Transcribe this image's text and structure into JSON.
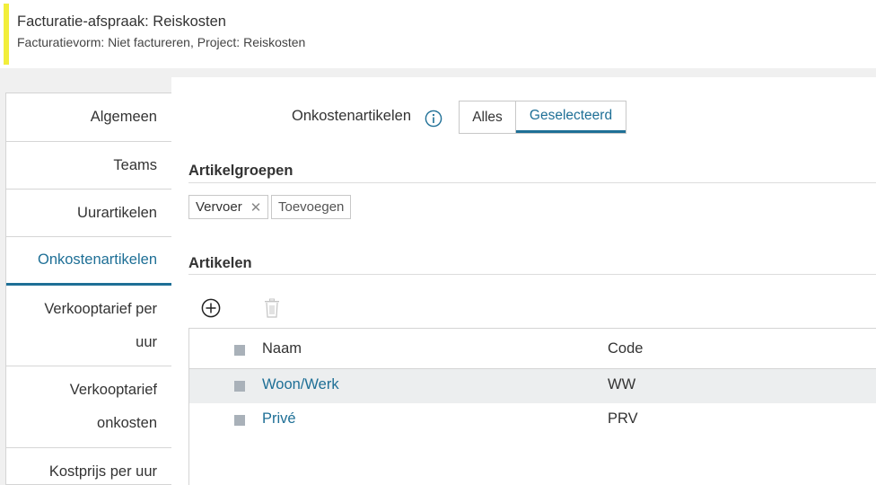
{
  "header": {
    "title": "Facturatie-afspraak: Reiskosten",
    "subtitle": "Facturatievorm: Niet factureren, Project: Reiskosten",
    "accent_color": "#f2ee3b"
  },
  "sidebar": {
    "items": [
      {
        "label": "Algemeen"
      },
      {
        "label": "Teams"
      },
      {
        "label": "Uurartikelen"
      },
      {
        "label": "Onkostenartikelen",
        "active": true
      },
      {
        "label_line1": "Verkooptarief per",
        "label_line2": "uur"
      },
      {
        "label_line1": "Verkooptarief",
        "label_line2": "onkosten"
      },
      {
        "label": "Kostprijs per uur"
      }
    ]
  },
  "main": {
    "field_label": "Onkostenartikelen",
    "info_icon": "info-circle-icon",
    "toggle": {
      "options": [
        "Alles",
        "Geselecteerd"
      ],
      "selected": "Geselecteerd"
    },
    "artikelgroepen": {
      "title": "Artikelgroepen",
      "tags": [
        "Vervoer"
      ],
      "remove_icon": "close-icon",
      "add_label": "Toevoegen"
    },
    "artikelen": {
      "title": "Artikelen",
      "add_icon": "plus-circle-icon",
      "delete_icon": "trash-icon",
      "columns": [
        "Naam",
        "Code"
      ],
      "rows": [
        {
          "name": "Woon/Werk",
          "code": "WW"
        },
        {
          "name": "Privé",
          "code": "PRV"
        }
      ]
    }
  },
  "colors": {
    "accent_blue": "#1e6f96",
    "background_gray": "#f0f0f0",
    "selected_row": "#eceeef"
  }
}
